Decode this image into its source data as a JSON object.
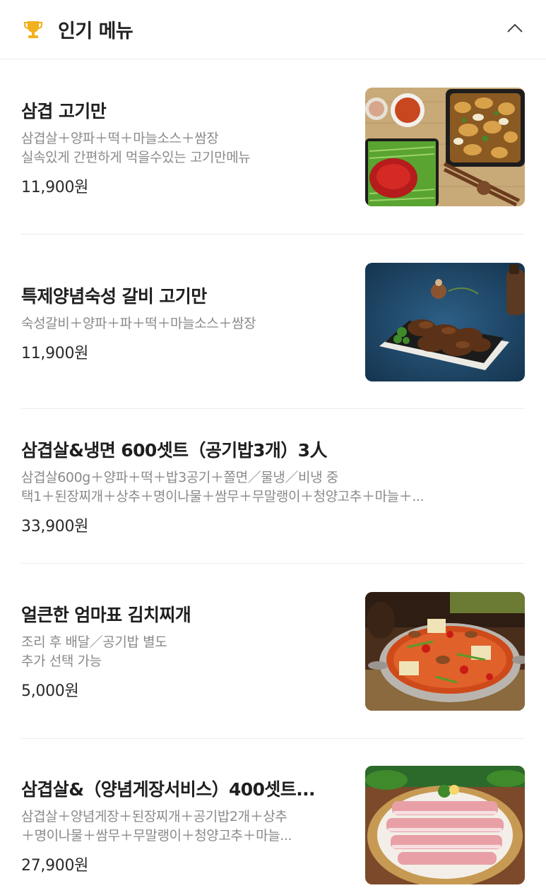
{
  "section": {
    "title": "인기 메뉴",
    "trophy_icon": "trophy-icon",
    "collapse_icon": "chevron-up-icon"
  },
  "items": [
    {
      "name": "삼겹 고기만",
      "desc_lines": [
        "삼겹살＋양파＋떡＋마늘소스＋쌈장",
        "실속있게 간편하게 먹을수있는 고기만메뉴"
      ],
      "price": "11,900원",
      "image": "pork-platter-photo"
    },
    {
      "name": "특제양념숙성 갈비 고기만",
      "desc_lines": [
        "숙성갈비＋양파＋파＋떡＋마늘소스＋쌈장"
      ],
      "price": "11,900원",
      "image": "galbi-photo"
    },
    {
      "name": "삼겹살&냉면 600셋트（공기밥3개）3人",
      "desc_lines": [
        "삼겹살600g＋양파＋떡＋밥3공기＋쫄면／물냉／비냉 중",
        "택1＋된장찌개＋상추＋명이나물＋쌈무＋무말랭이＋청양고추＋마늘＋..."
      ],
      "price": "33,900원",
      "image": null
    },
    {
      "name": "얼큰한 엄마표 김치찌개",
      "desc_lines": [
        "조리 후 배달／공기밥 별도",
        "추가 선택 가능"
      ],
      "price": "5,000원",
      "image": "kimchi-stew-photo"
    },
    {
      "name": "삼겹살&（양념게장서비스）400셋트...",
      "desc_lines": [
        "삼겹살＋양념게장＋된장찌개＋공기밥2개＋상추",
        "＋명이나물＋쌈무＋무말랭이＋청양고추＋마늘..."
      ],
      "price": "27,900원",
      "image": "raw-pork-photo"
    }
  ],
  "colors": {
    "trophy": "#f2b01e",
    "divider": "#ececec",
    "desc": "#8a8a8a"
  }
}
